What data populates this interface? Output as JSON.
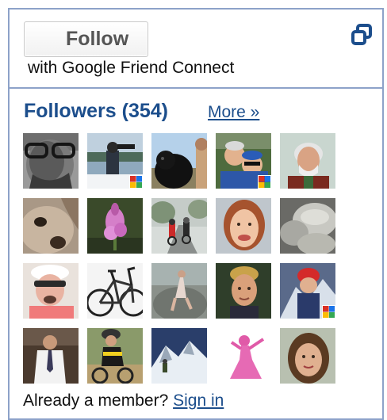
{
  "follow": {
    "button_label": "Follow",
    "subtitle": "with Google Friend Connect",
    "popout_icon": "popout-windows-icon"
  },
  "followers": {
    "heading": "Followers (354)",
    "more_label": "More »",
    "avatars": [
      {
        "name": "avatar-bw-glasses-man",
        "badge": false
      },
      {
        "name": "avatar-lake-photographer",
        "badge": true
      },
      {
        "name": "avatar-black-dog",
        "badge": false
      },
      {
        "name": "avatar-cyclists-helmets",
        "badge": true
      },
      {
        "name": "avatar-grey-haired-man",
        "badge": false
      },
      {
        "name": "avatar-dog-closeup",
        "badge": false
      },
      {
        "name": "avatar-pink-flower",
        "badge": false
      },
      {
        "name": "avatar-road-cyclists",
        "badge": false
      },
      {
        "name": "avatar-smiling-woman",
        "badge": false
      },
      {
        "name": "avatar-rocks",
        "badge": false
      },
      {
        "name": "avatar-cyclist-sunglasses",
        "badge": false
      },
      {
        "name": "avatar-bicycle",
        "badge": false
      },
      {
        "name": "avatar-woman-on-rocks",
        "badge": false
      },
      {
        "name": "avatar-man-portrait",
        "badge": false
      },
      {
        "name": "avatar-climber-red-helmet",
        "badge": true
      },
      {
        "name": "avatar-man-in-shirt",
        "badge": false
      },
      {
        "name": "avatar-mountain-biker",
        "badge": false
      },
      {
        "name": "avatar-snowy-mountain",
        "badge": false
      },
      {
        "name": "avatar-pink-silhouette",
        "badge": false
      },
      {
        "name": "avatar-woman-portrait",
        "badge": false
      }
    ]
  },
  "footer": {
    "prompt": "Already a member? ",
    "signin_label": "Sign in"
  },
  "colors": {
    "border": "#8da2c9",
    "link": "#1c4e8c",
    "icon": "#1c4e8c"
  }
}
